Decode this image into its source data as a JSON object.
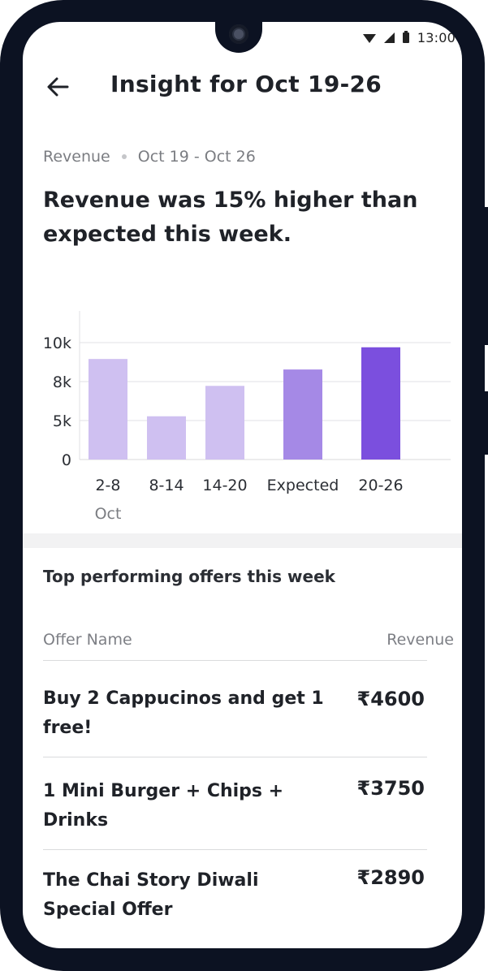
{
  "status_bar": {
    "time": "13:00",
    "icons": [
      "wifi-icon",
      "signal-icon",
      "battery-icon"
    ]
  },
  "header": {
    "title": "Insight for Oct 19-26",
    "back_icon": "arrow-left-icon"
  },
  "summary": {
    "metric": "Revenue",
    "date_range": "Oct 19 - Oct 26",
    "headline": "Revenue was 15% higher than expected this week."
  },
  "chart_data": {
    "type": "bar",
    "categories": [
      "2-8",
      "8-14",
      "14-20",
      "Expected",
      "20-26"
    ],
    "x_sublabel": "Oct",
    "values": [
      8600,
      3700,
      6300,
      7700,
      9600
    ],
    "ytick_labels": [
      "0",
      "5k",
      "8k",
      "10k"
    ],
    "ytick_values": [
      0,
      3333,
      6667,
      10000
    ],
    "ylim": [
      0,
      12000
    ],
    "grid": true,
    "colors": [
      "#cfc0f1",
      "#cfc0f1",
      "#cfc0f1",
      "#a589e6",
      "#7b4fde"
    ]
  },
  "offers": {
    "title": "Top performing offers this week",
    "col_name": "Offer Name",
    "col_revenue": "Revenue",
    "rows": [
      {
        "name_line1": "Buy 2 Cappucinos and get 1",
        "name_line2": "free!",
        "revenue": "₹4600"
      },
      {
        "name_line1": "1 Mini Burger + Chips +",
        "name_line2": "Drinks",
        "revenue": "₹3750"
      },
      {
        "name_line1": "The Chai Story Diwali",
        "name_line2": "Special Offer",
        "revenue": "₹2890"
      }
    ]
  }
}
